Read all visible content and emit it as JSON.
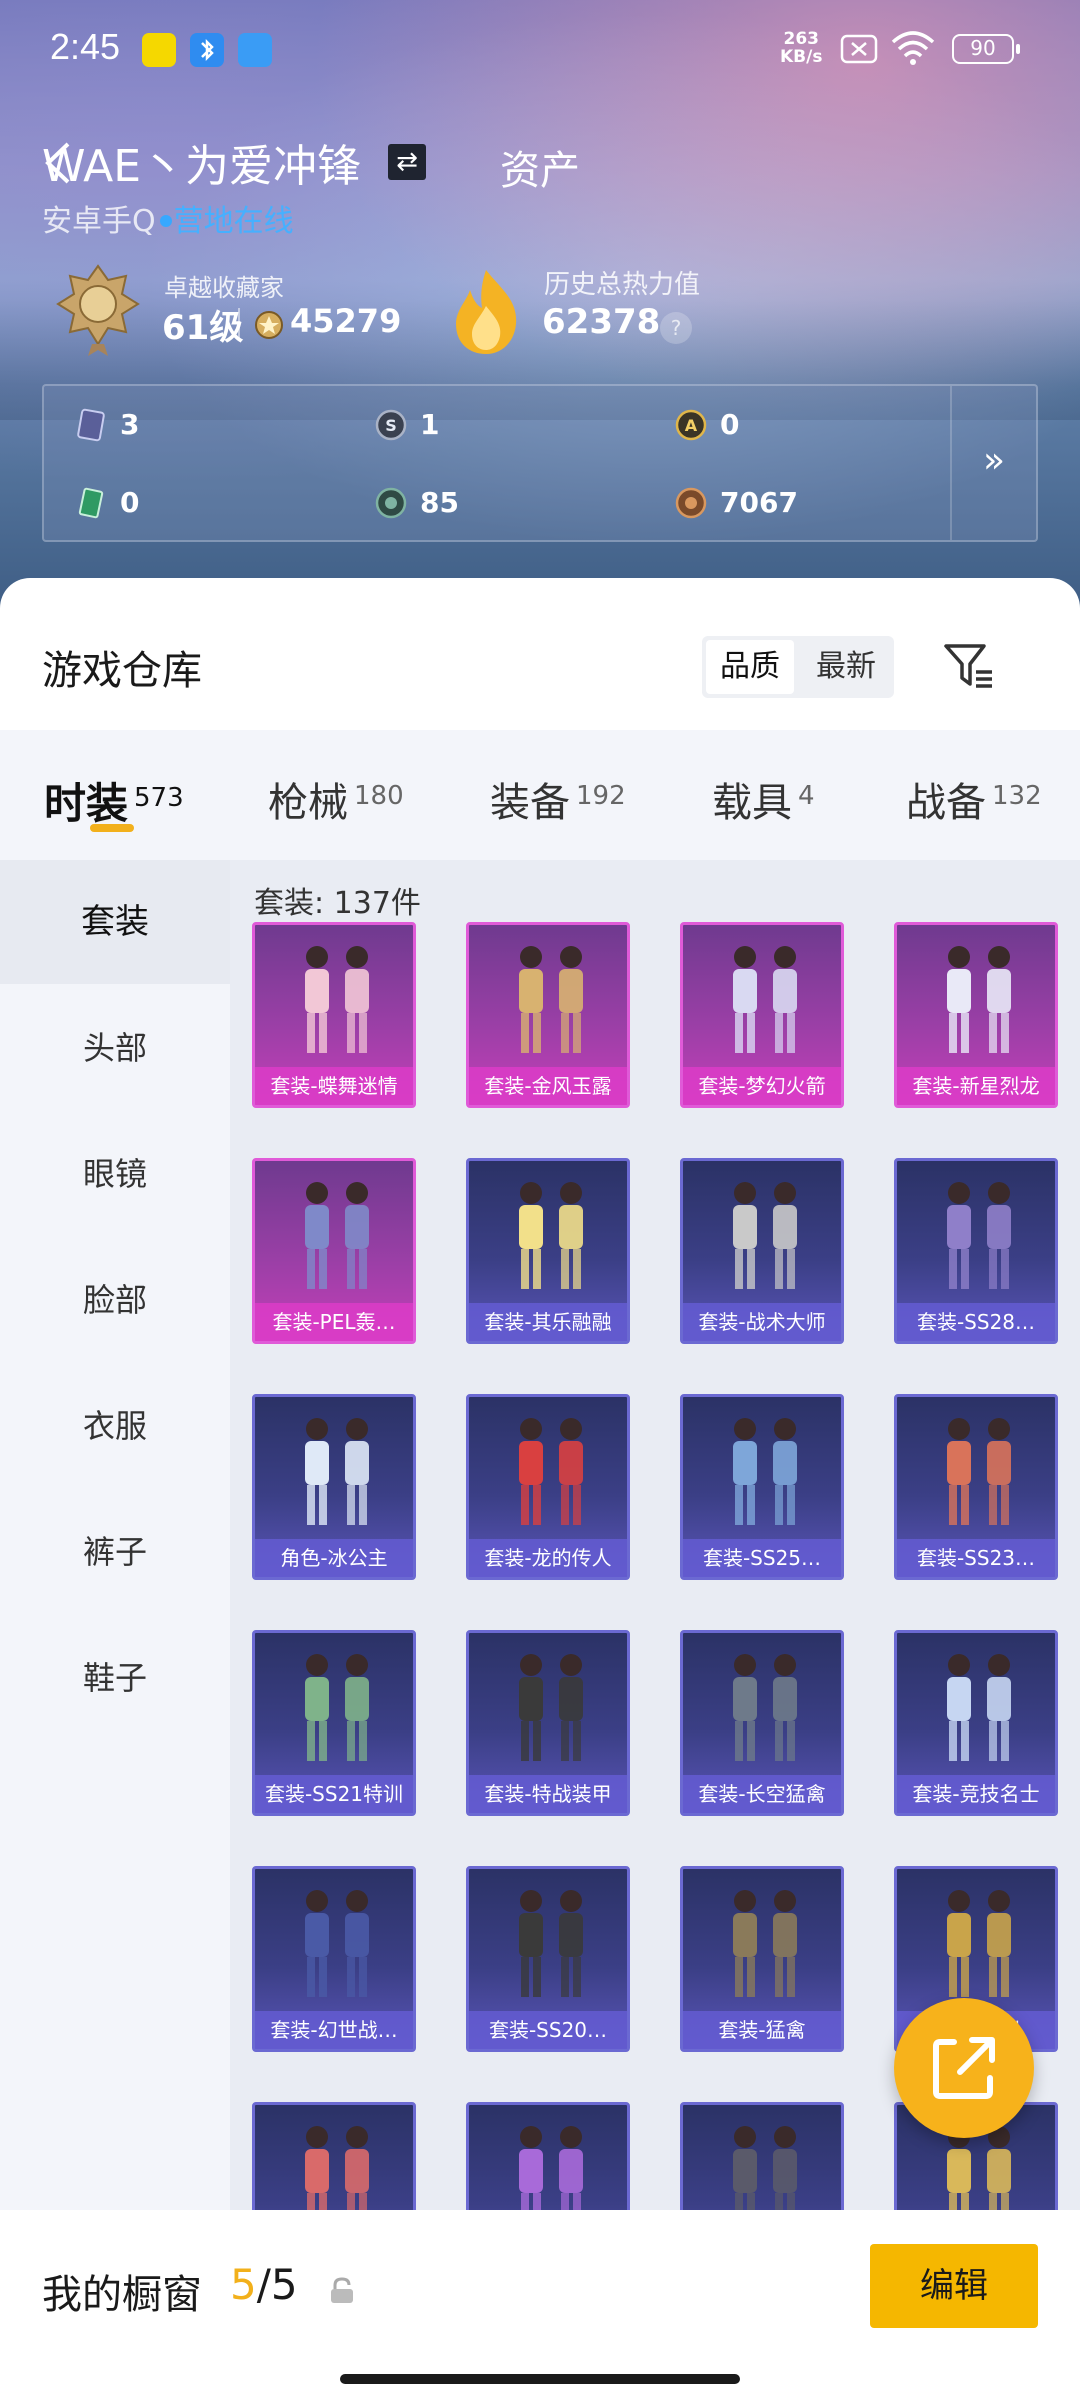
{
  "status_bar": {
    "time": "2:45",
    "net_speed_value": "263",
    "net_speed_unit": "KB/s",
    "battery": "90"
  },
  "profile": {
    "nickname": "WAE丶为爱冲锋",
    "asset_tab": "资产",
    "platform": "安卓手Q",
    "online_status": "营地在线",
    "rank_title": "卓越收藏家",
    "rank_level": "61级",
    "rank_coins": "45279",
    "heat_title": "历史总热力值",
    "heat_value": "62378",
    "help": "?"
  },
  "currencies": [
    {
      "icon": "card-icon",
      "value": "3"
    },
    {
      "icon": "s-coin-icon",
      "value": "1"
    },
    {
      "icon": "a-coin-icon",
      "value": "0"
    },
    {
      "icon": "green-ticket-icon",
      "value": "0"
    },
    {
      "icon": "green-coin-icon",
      "value": "85"
    },
    {
      "icon": "bronze-coin-icon",
      "value": "7067"
    }
  ],
  "warehouse": {
    "title": "游戏仓库",
    "sort_options": [
      "品质",
      "最新"
    ],
    "active_sort": "品质"
  },
  "category_tabs": [
    {
      "label": "时装",
      "count": "573",
      "active": true
    },
    {
      "label": "枪械",
      "count": "180",
      "active": false
    },
    {
      "label": "装备",
      "count": "192",
      "active": false
    },
    {
      "label": "载具",
      "count": "4",
      "active": false
    },
    {
      "label": "战备",
      "count": "132",
      "active": false
    }
  ],
  "sidebar": {
    "items": [
      "套装",
      "头部",
      "眼镜",
      "脸部",
      "衣服",
      "裤子",
      "鞋子"
    ],
    "active": "套装"
  },
  "grid": {
    "heading": "套装: 137件",
    "items": [
      {
        "label": "套装-蝶舞迷情",
        "rarity": "purple"
      },
      {
        "label": "套装-金风玉露",
        "rarity": "purple"
      },
      {
        "label": "套装-梦幻火箭",
        "rarity": "purple"
      },
      {
        "label": "套装-新星烈龙",
        "rarity": "purple"
      },
      {
        "label": "套装-PEL轰…",
        "rarity": "purple"
      },
      {
        "label": "套装-其乐融融",
        "rarity": "blue"
      },
      {
        "label": "套装-战术大师",
        "rarity": "blue"
      },
      {
        "label": "套装-SS28…",
        "rarity": "blue"
      },
      {
        "label": "角色-冰公主",
        "rarity": "blue"
      },
      {
        "label": "套装-龙的传人",
        "rarity": "blue"
      },
      {
        "label": "套装-SS25…",
        "rarity": "blue"
      },
      {
        "label": "套装-SS23…",
        "rarity": "blue"
      },
      {
        "label": "套装-SS21特训",
        "rarity": "blue"
      },
      {
        "label": "套装-特战装甲",
        "rarity": "blue"
      },
      {
        "label": "套装-长空猛禽",
        "rarity": "blue"
      },
      {
        "label": "套装-竞技名士",
        "rarity": "blue"
      },
      {
        "label": "套装-幻世战…",
        "rarity": "blue"
      },
      {
        "label": "套装-SS20…",
        "rarity": "blue"
      },
      {
        "label": "套装-猛禽",
        "rarity": "blue"
      },
      {
        "label": "套装-…训",
        "rarity": "blue"
      },
      {
        "label": "",
        "rarity": "blue"
      },
      {
        "label": "",
        "rarity": "blue"
      },
      {
        "label": "",
        "rarity": "blue"
      },
      {
        "label": "",
        "rarity": "blue"
      }
    ]
  },
  "showcase": {
    "label": "我的橱窗",
    "current": "5",
    "separator": "/",
    "total": "5",
    "edit_label": "编辑"
  },
  "colors": {
    "accent": "#f5b700",
    "online": "#46b0ff",
    "rarity_purple": "#e05ad8",
    "rarity_blue": "#6b69d2"
  }
}
